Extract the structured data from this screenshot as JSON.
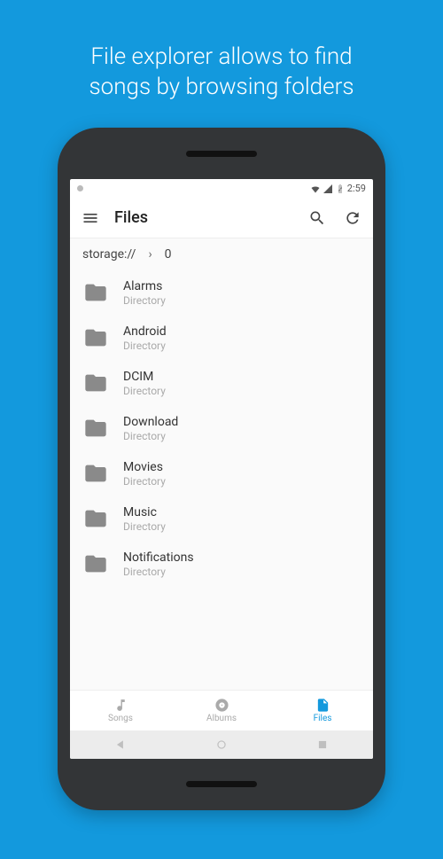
{
  "promo": {
    "line1": "File explorer allows to find",
    "line2": "songs by browsing folders"
  },
  "status": {
    "time": "2:59"
  },
  "appbar": {
    "title": "Files"
  },
  "breadcrumb": {
    "root": "storage://",
    "current": "0"
  },
  "files": [
    {
      "name": "Alarms",
      "type": "Directory"
    },
    {
      "name": "Android",
      "type": "Directory"
    },
    {
      "name": "DCIM",
      "type": "Directory"
    },
    {
      "name": "Download",
      "type": "Directory"
    },
    {
      "name": "Movies",
      "type": "Directory"
    },
    {
      "name": "Music",
      "type": "Directory"
    },
    {
      "name": "Notifications",
      "type": "Directory"
    }
  ],
  "nav": {
    "songs": "Songs",
    "albums": "Albums",
    "files": "Files"
  }
}
